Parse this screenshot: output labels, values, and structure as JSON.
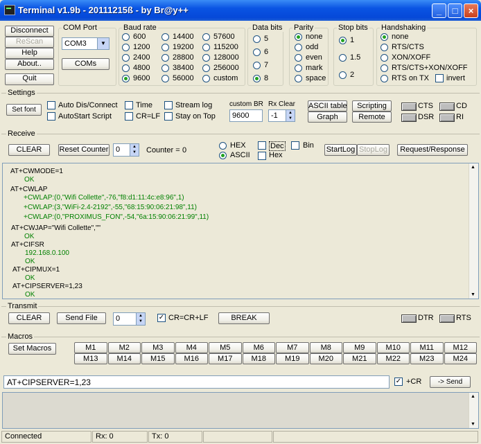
{
  "window": {
    "title": "Terminal v1.9b - 20111215ß - by Br@y++",
    "min": "_",
    "max": "□",
    "close": "×"
  },
  "left_buttons": {
    "disconnect": "Disconnect",
    "rescan": "ReScan",
    "help": "Help",
    "about": "About..",
    "quit": "Quit"
  },
  "com_port": {
    "title": "COM Port",
    "value": "COM3",
    "coms_button": "COMs"
  },
  "baud_rate": {
    "title": "Baud rate",
    "options": [
      "600",
      "1200",
      "2400",
      "4800",
      "9600",
      "14400",
      "19200",
      "28800",
      "38400",
      "56000",
      "57600",
      "115200",
      "128000",
      "256000",
      "custom"
    ],
    "selected": "9600"
  },
  "data_bits": {
    "title": "Data bits",
    "options": [
      "5",
      "6",
      "7",
      "8"
    ],
    "selected": "8"
  },
  "parity": {
    "title": "Parity",
    "options": [
      "none",
      "odd",
      "even",
      "mark",
      "space"
    ],
    "selected": "none"
  },
  "stop_bits": {
    "title": "Stop bits",
    "options": [
      "1",
      "1.5",
      "2"
    ],
    "selected": "1"
  },
  "handshaking": {
    "title": "Handshaking",
    "options": [
      "none",
      "RTS/CTS",
      "XON/XOFF",
      "RTS/CTS+XON/XOFF",
      "RTS on TX"
    ],
    "selected": "none",
    "invert_label": "invert"
  },
  "settings": {
    "title": "Settings",
    "set_font": "Set font",
    "auto_dis_connect": "Auto Dis/Connect",
    "autostart_script": "AutoStart Script",
    "time": "Time",
    "cr_lf": "CR=LF",
    "stream_log": "Stream log",
    "stay_on_top": "Stay on Top",
    "custom_br_label": "custom BR",
    "custom_br_value": "9600",
    "rx_clear_label": "Rx Clear",
    "rx_clear_value": "-1",
    "ascii_table": "ASCII table",
    "graph": "Graph",
    "scripting": "Scripting",
    "remote": "Remote",
    "leds": [
      "CTS",
      "CD",
      "DSR",
      "RI"
    ]
  },
  "receive": {
    "title": "Receive",
    "clear": "CLEAR",
    "reset_counter": "Reset Counter",
    "counter_spin": "0",
    "counter_label": "Counter =",
    "counter_value": "0",
    "hex": "HEX",
    "ascii": "ASCII",
    "dec": "Dec",
    "hex_cb": "Hex",
    "bin": "Bin",
    "startlog": "StartLog",
    "stoplog": "StopLog",
    "request_response": "Request/Response"
  },
  "terminal_lines": [
    {
      "text": "AT+CWMODE=1",
      "ok": false
    },
    {
      "text": "OK",
      "ok": true
    },
    {
      "text": "AT+CWLAP",
      "ok": false
    },
    {
      "text": "+CWLAP:(0,\"Wifi Collette\",-76,\"f8:d1:11:4c:e8:96\",1)",
      "ok": true
    },
    {
      "text": "+CWLAP:(3,\"WiFi-2.4-2192\",-55,\"68:15:90:06:21:98\",11)",
      "ok": true
    },
    {
      "text": "+CWLAP:(0,\"PROXIMUS_FON\",-54,\"6a:15:90:06:21:99\",11)",
      "ok": true
    },
    {
      "text": "AT+CWJAP=\"Wifi Collette\",\"\"",
      "ok": false
    },
    {
      "text": "OK",
      "ok": true
    },
    {
      "text": "AT+CIFSR",
      "ok": false
    },
    {
      "text": "192.168.0.100",
      "ok": true
    },
    {
      "text": "OK",
      "ok": true
    },
    {
      "text": "AT+CIPMUX=1",
      "ok": false
    },
    {
      "text": "OK",
      "ok": true
    },
    {
      "text": "AT+CIPSERVER=1,23",
      "ok": false
    },
    {
      "text": "OK",
      "ok": true
    }
  ],
  "transmit": {
    "title": "Transmit",
    "clear": "CLEAR",
    "send_file": "Send File",
    "spin": "0",
    "cr_crlf": "CR=CR+LF",
    "break": "BREAK",
    "leds": [
      "DTR",
      "RTS"
    ]
  },
  "macros": {
    "title": "Macros",
    "set_macros": "Set Macros",
    "items": [
      "M1",
      "M2",
      "M3",
      "M4",
      "M5",
      "M6",
      "M7",
      "M8",
      "M9",
      "M10",
      "M11",
      "M12",
      "M13",
      "M14",
      "M15",
      "M16",
      "M17",
      "M18",
      "M19",
      "M20",
      "M21",
      "M22",
      "M23",
      "M24"
    ]
  },
  "send_bar": {
    "input": "AT+CIPSERVER=1,23",
    "plus_cr": "+CR",
    "send": "-> Send"
  },
  "status": {
    "state": "Connected",
    "rx": "Rx: 0",
    "tx": "Tx: 0"
  },
  "colors": {
    "title_blue": "#0a54e3",
    "ok_green": "#008000",
    "panel": "#ece9d8"
  }
}
